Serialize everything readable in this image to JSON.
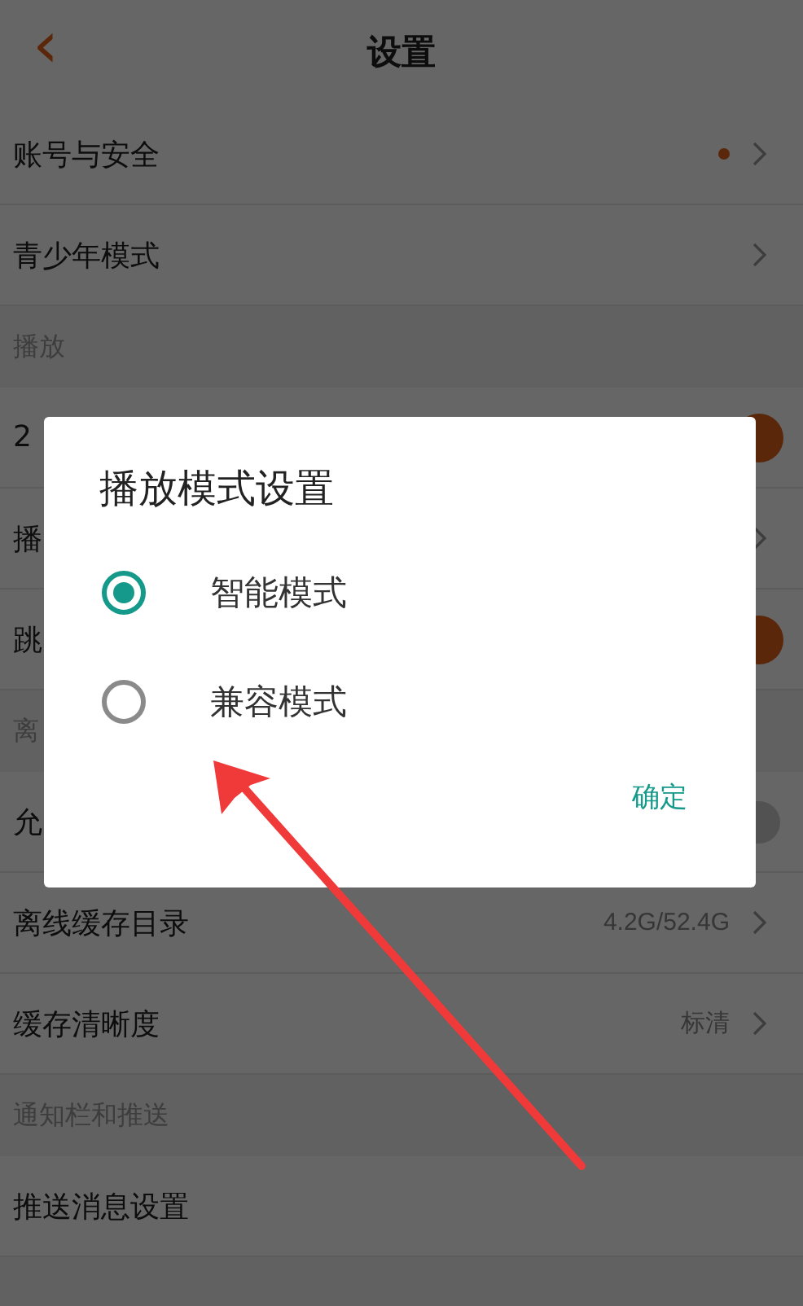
{
  "header": {
    "back": "‹",
    "title": "设置"
  },
  "list": [
    {
      "kind": "row",
      "label": "账号与安全",
      "dot": true,
      "chevron": true
    },
    {
      "kind": "row",
      "label": "青少年模式",
      "dot": false,
      "chevron": true
    },
    {
      "kind": "section",
      "label": "播放"
    },
    {
      "kind": "toggle",
      "label": "2",
      "on": true
    },
    {
      "kind": "row",
      "label": "播",
      "dot": false,
      "chevron": true
    },
    {
      "kind": "toggle",
      "label": "跳",
      "on": true
    },
    {
      "kind": "section",
      "label": "离"
    },
    {
      "kind": "toggle",
      "label": "允",
      "on": false
    },
    {
      "kind": "row",
      "label": "离线缓存目录",
      "value": "4.2G/52.4G",
      "dot": false,
      "chevron": true
    },
    {
      "kind": "row",
      "label": "缓存清晰度",
      "value": "标清",
      "dot": false,
      "chevron": true
    },
    {
      "kind": "section",
      "label": "通知栏和推送"
    },
    {
      "kind": "row",
      "label": "推送消息设置",
      "dot": false,
      "chevron": false
    }
  ],
  "dialog": {
    "title": "播放模式设置",
    "options": [
      {
        "label": "智能模式",
        "selected": true
      },
      {
        "label": "兼容模式",
        "selected": false
      }
    ],
    "confirm": "确定"
  },
  "annotation": {
    "kind": "arrow"
  }
}
